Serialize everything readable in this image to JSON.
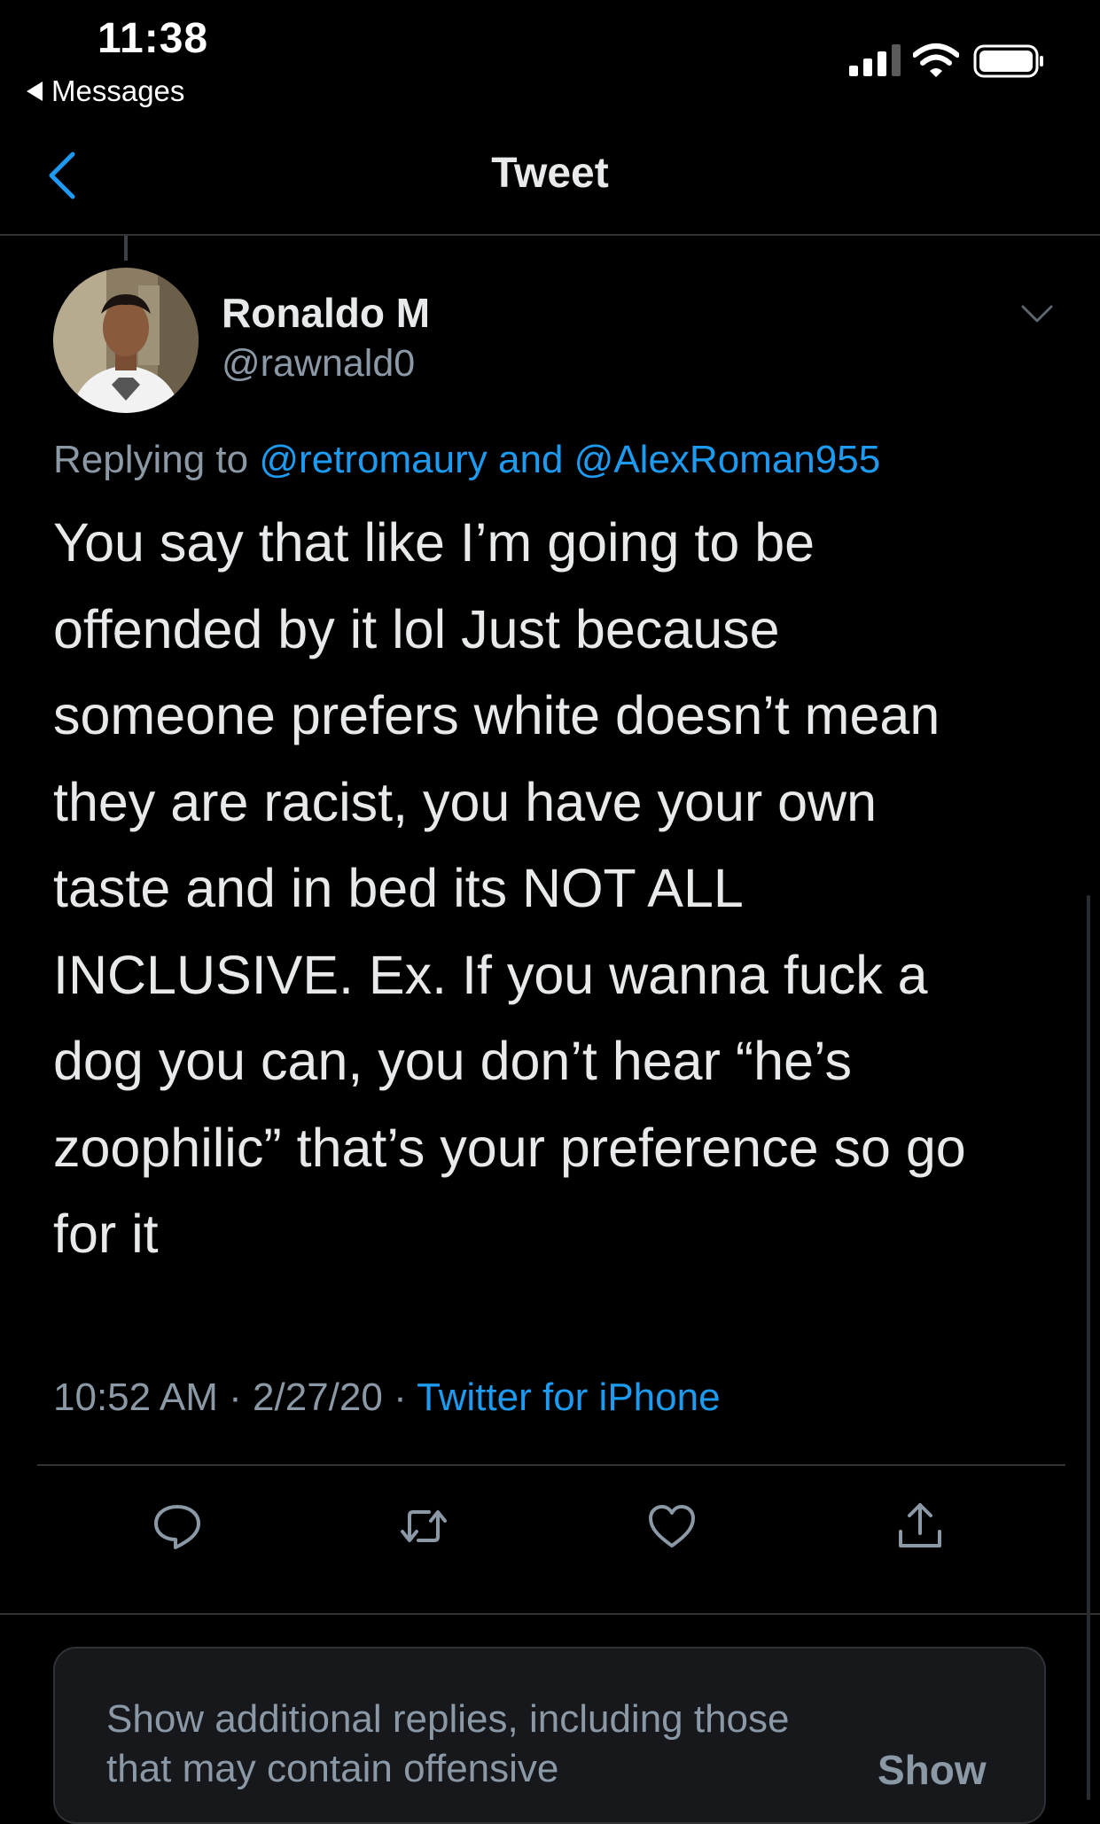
{
  "status_bar": {
    "time": "11:38",
    "back_app": "Messages"
  },
  "nav": {
    "title": "Tweet"
  },
  "tweet": {
    "display_name": "Ronaldo M",
    "handle": "@rawnald0",
    "replying_prefix": "Replying to",
    "reply_to_1": "@retromaury",
    "reply_and": "and",
    "reply_to_2": "@AlexRoman955",
    "text": "You say that like I’m going to be\noffended by it lol Just because\nsomeone prefers white doesn’t mean\nthey are racist, you have your own\ntaste and in bed its NOT ALL\nINCLUSIVE. Ex. If you wanna fuck a\ndog you can, you don’t hear “he’s\nzoophilic” that’s your preference so go\nfor it",
    "time": "10:52 AM",
    "separator": "·",
    "date": "2/27/20",
    "source": "Twitter for iPhone"
  },
  "actions": {
    "reply_icon": "comment-icon",
    "retweet_icon": "retweet-icon",
    "like_icon": "heart-icon",
    "share_icon": "share-icon"
  },
  "more_replies": {
    "text": "Show additional replies, including those that may contain offensive",
    "button": "Show"
  },
  "colors": {
    "background": "#000000",
    "text": "#e7e9ea",
    "secondary": "#8b98a5",
    "link": "#1d9bf0",
    "divider": "#2f3336"
  }
}
